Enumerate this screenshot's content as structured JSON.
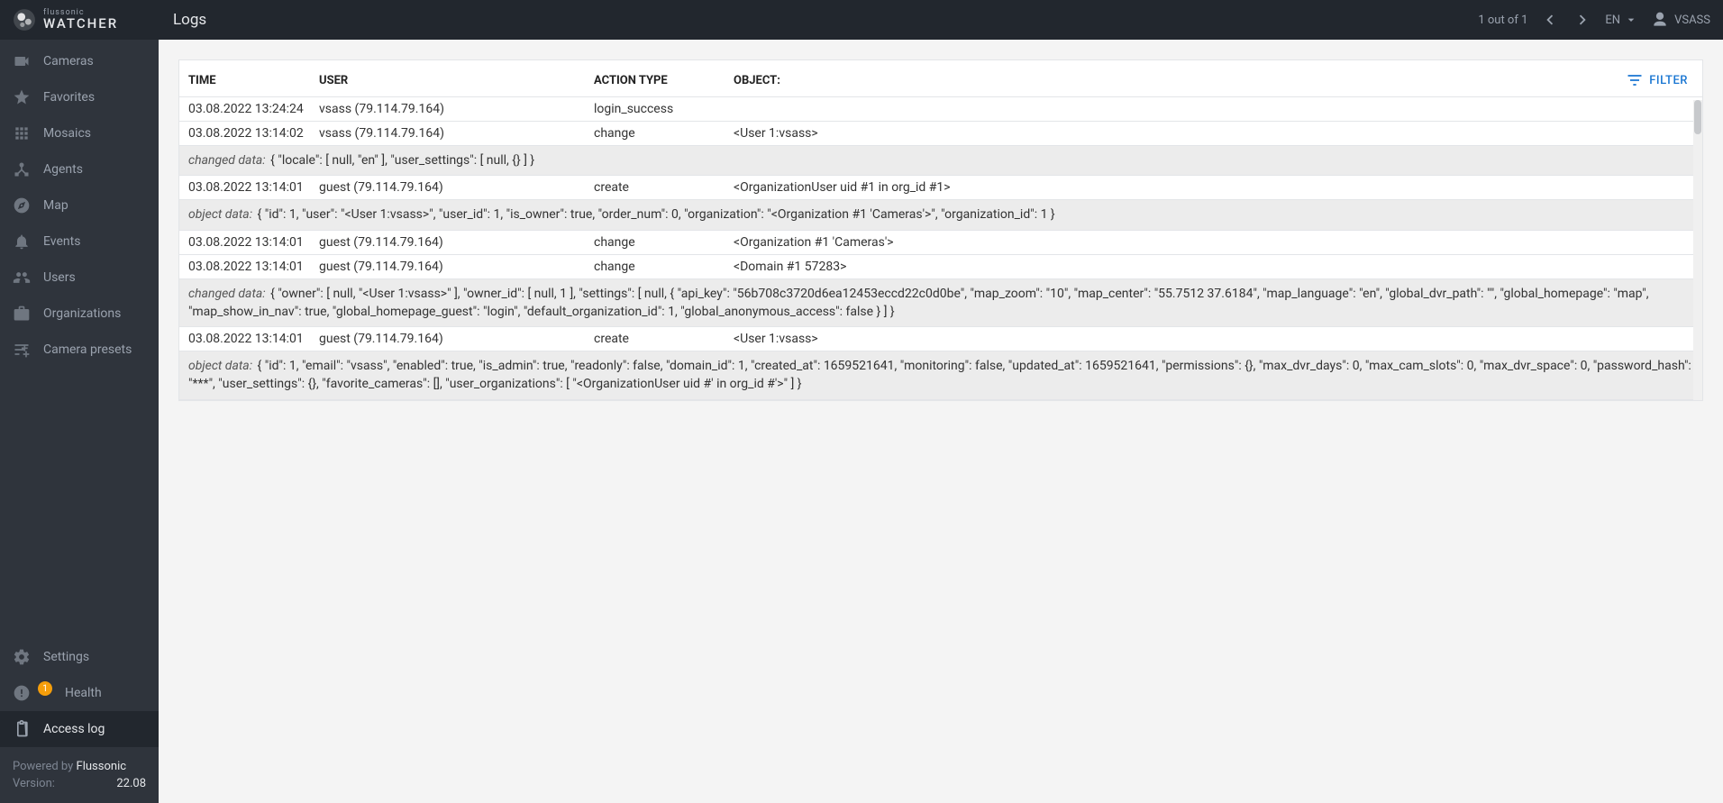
{
  "header": {
    "brand_small": "flussonic",
    "brand_large": "WATCHER",
    "page_title": "Logs",
    "pagination": "1 out of 1",
    "lang": "EN",
    "username": "VSASS"
  },
  "sidebar": {
    "main": [
      {
        "key": "cameras",
        "label": "Cameras",
        "icon": "videocam"
      },
      {
        "key": "favorites",
        "label": "Favorites",
        "icon": "star"
      },
      {
        "key": "mosaics",
        "label": "Mosaics",
        "icon": "apps"
      },
      {
        "key": "agents",
        "label": "Agents",
        "icon": "device-hub"
      },
      {
        "key": "map",
        "label": "Map",
        "icon": "explore"
      },
      {
        "key": "events",
        "label": "Events",
        "icon": "bell"
      },
      {
        "key": "users",
        "label": "Users",
        "icon": "group"
      },
      {
        "key": "organizations",
        "label": "Organizations",
        "icon": "briefcase"
      },
      {
        "key": "camera-presets",
        "label": "Camera presets",
        "icon": "tune"
      }
    ],
    "bottom": [
      {
        "key": "settings",
        "label": "Settings",
        "icon": "gear"
      },
      {
        "key": "health",
        "label": "Health",
        "icon": "error",
        "badge": "1"
      },
      {
        "key": "access-log",
        "label": "Access log",
        "icon": "clipboard",
        "active": true
      }
    ],
    "footer": {
      "powered_label": "Powered by",
      "powered_value": "Flussonic",
      "version_label": "Version:",
      "version_value": "22.08"
    }
  },
  "table": {
    "columns": {
      "time": "TIME",
      "user": "USER",
      "action": "ACTION TYPE",
      "object": "OBJECT:"
    },
    "filter_label": "FILTER",
    "rows": [
      {
        "type": "entry",
        "time": "03.08.2022 13:24:24",
        "user": "vsass (79.114.79.164)",
        "action": "login_success",
        "object": ""
      },
      {
        "type": "entry",
        "time": "03.08.2022 13:14:02",
        "user": "vsass (79.114.79.164)",
        "action": "change",
        "object": "<User 1:vsass>"
      },
      {
        "type": "detail",
        "label": "changed data:",
        "text": "{ \"locale\": [ null, \"en\" ], \"user_settings\": [ null, {} ] }"
      },
      {
        "type": "entry",
        "time": "03.08.2022 13:14:01",
        "user": "guest (79.114.79.164)",
        "action": "create",
        "object": "<OrganizationUser uid #1 in org_id #1>"
      },
      {
        "type": "detail",
        "label": "object data:",
        "text": "{ \"id\": 1, \"user\": \"<User 1:vsass>\", \"user_id\": 1, \"is_owner\": true, \"order_num\": 0, \"organization\": \"<Organization #1 'Cameras'>\", \"organization_id\": 1 }"
      },
      {
        "type": "entry",
        "time": "03.08.2022 13:14:01",
        "user": "guest (79.114.79.164)",
        "action": "change",
        "object": "<Organization #1 'Cameras'>"
      },
      {
        "type": "entry",
        "time": "03.08.2022 13:14:01",
        "user": "guest (79.114.79.164)",
        "action": "change",
        "object": "<Domain #1 57283>"
      },
      {
        "type": "detail",
        "label": "changed data:",
        "text": "{ \"owner\": [ null, \"<User 1:vsass>\" ], \"owner_id\": [ null, 1 ], \"settings\": [ null, { \"api_key\": \"56b708c3720d6ea12453eccd22c0d0be\", \"map_zoom\": \"10\", \"map_center\": \"55.7512 37.6184\", \"map_language\": \"en\", \"global_dvr_path\": \"\", \"global_homepage\": \"map\", \"map_show_in_nav\": true, \"global_homepage_guest\": \"login\", \"default_organization_id\": 1, \"global_anonymous_access\": false } ] }"
      },
      {
        "type": "entry",
        "time": "03.08.2022 13:14:01",
        "user": "guest (79.114.79.164)",
        "action": "create",
        "object": "<User 1:vsass>"
      },
      {
        "type": "detail",
        "label": "object data:",
        "text": "{ \"id\": 1, \"email\": \"vsass\", \"enabled\": true, \"is_admin\": true, \"readonly\": false, \"domain_id\": 1, \"created_at\": 1659521641, \"monitoring\": false, \"updated_at\": 1659521641, \"permissions\": {}, \"max_dvr_days\": 0, \"max_cam_slots\": 0, \"max_dvr_space\": 0, \"password_hash\": \"***\", \"user_settings\": {}, \"favorite_cameras\": [], \"user_organizations\": [ \"<OrganizationUser uid #' in org_id #'>\" ] }"
      }
    ]
  }
}
